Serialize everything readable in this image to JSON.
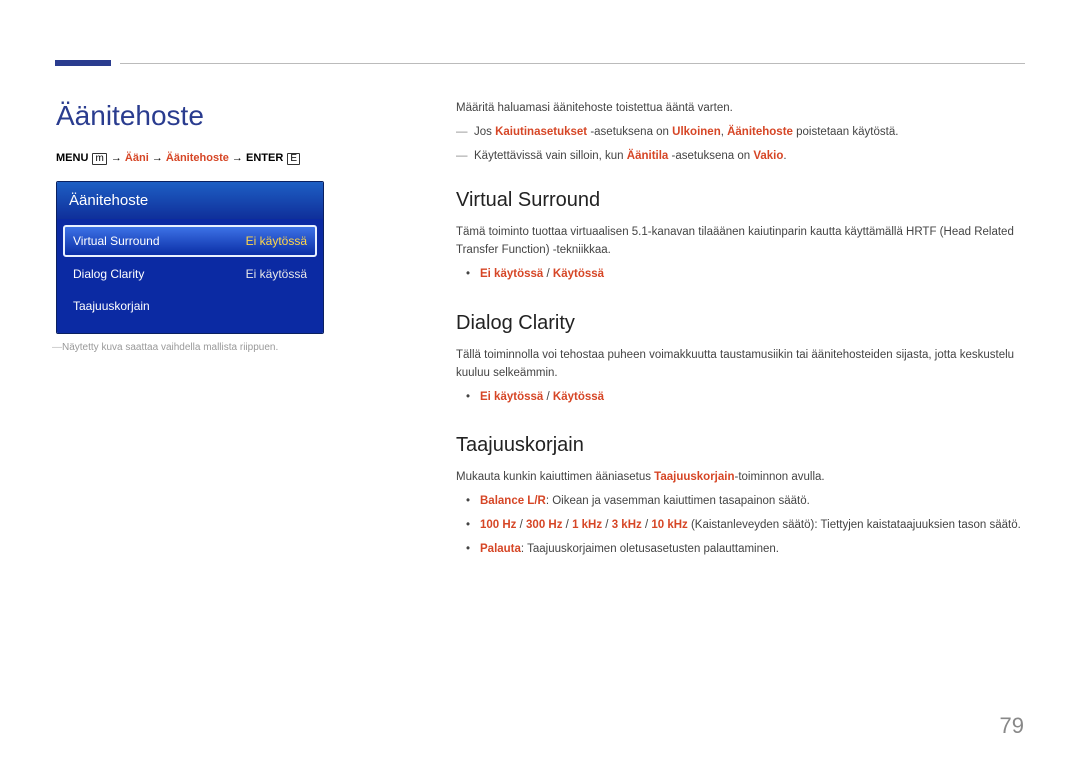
{
  "page_title": "Äänitehoste",
  "breadcrumb": {
    "menu_label": "MENU",
    "arrow": "→",
    "path1": "Ääni",
    "path2": "Äänitehoste",
    "enter_label": "ENTER",
    "menu_icon": "m",
    "enter_icon": "E"
  },
  "menu": {
    "header": "Äänitehoste",
    "rows": [
      {
        "label": "Virtual Surround",
        "value": "Ei käytössä",
        "selected": true
      },
      {
        "label": "Dialog Clarity",
        "value": "Ei käytössä",
        "selected": false
      },
      {
        "label": "Taajuuskorjain",
        "value": "",
        "selected": false
      }
    ]
  },
  "figure_note": "Näytetty kuva saattaa vaihdella mallista riippuen.",
  "intro": "Määritä haluamasi äänitehoste toistettua ääntä varten.",
  "dash_notes": [
    {
      "pre": "Jos ",
      "red1": "Kaiutinasetukset",
      "mid1": " -asetuksena on ",
      "red2": "Ulkoinen",
      "mid2": ", ",
      "red3": "Äänitehoste",
      "post": " poistetaan käytöstä."
    },
    {
      "pre": "Käytettävissä vain silloin, kun ",
      "red1": "Äänitila",
      "mid1": " -asetuksena on ",
      "red2": "Vakio",
      "mid2": ".",
      "red3": "",
      "post": ""
    }
  ],
  "sections": {
    "virtual_surround": {
      "title": "Virtual Surround",
      "body": "Tämä toiminto tuottaa virtuaalisen 5.1-kanavan tilaäänen kaiutinparin kautta käyttämällä HRTF (Head Related Transfer Function) -tekniikkaa.",
      "opt_off": "Ei käytössä",
      "opt_on": "Käytössä",
      "opt_sep": " / "
    },
    "dialog_clarity": {
      "title": "Dialog Clarity",
      "body": "Tällä toiminnolla voi tehostaa puheen voimakkuutta taustamusiikin tai äänitehosteiden sijasta, jotta keskustelu kuuluu selkeämmin.",
      "opt_off": "Ei käytössä",
      "opt_on": "Käytössä",
      "opt_sep": " / "
    },
    "equalizer": {
      "title": "Taajuuskorjain",
      "intro_pre": "Mukauta kunkin kaiuttimen ääniasetus ",
      "intro_red": "Taajuuskorjain",
      "intro_post": "-toiminnon avulla.",
      "items": [
        {
          "label": "Balance L/R",
          "rest": ": Oikean ja vasemman kaiuttimen tasapainon säätö."
        },
        {
          "labels": [
            "100 Hz",
            "300 Hz",
            "1 kHz",
            "3 kHz",
            "10 kHz"
          ],
          "sep": " / ",
          "rest": " (Kaistanleveyden säätö): Tiettyjen kaistataajuuksien tason säätö."
        },
        {
          "label": "Palauta",
          "rest": ": Taajuuskorjaimen oletusasetusten palauttaminen."
        }
      ]
    }
  },
  "page_number": "79"
}
